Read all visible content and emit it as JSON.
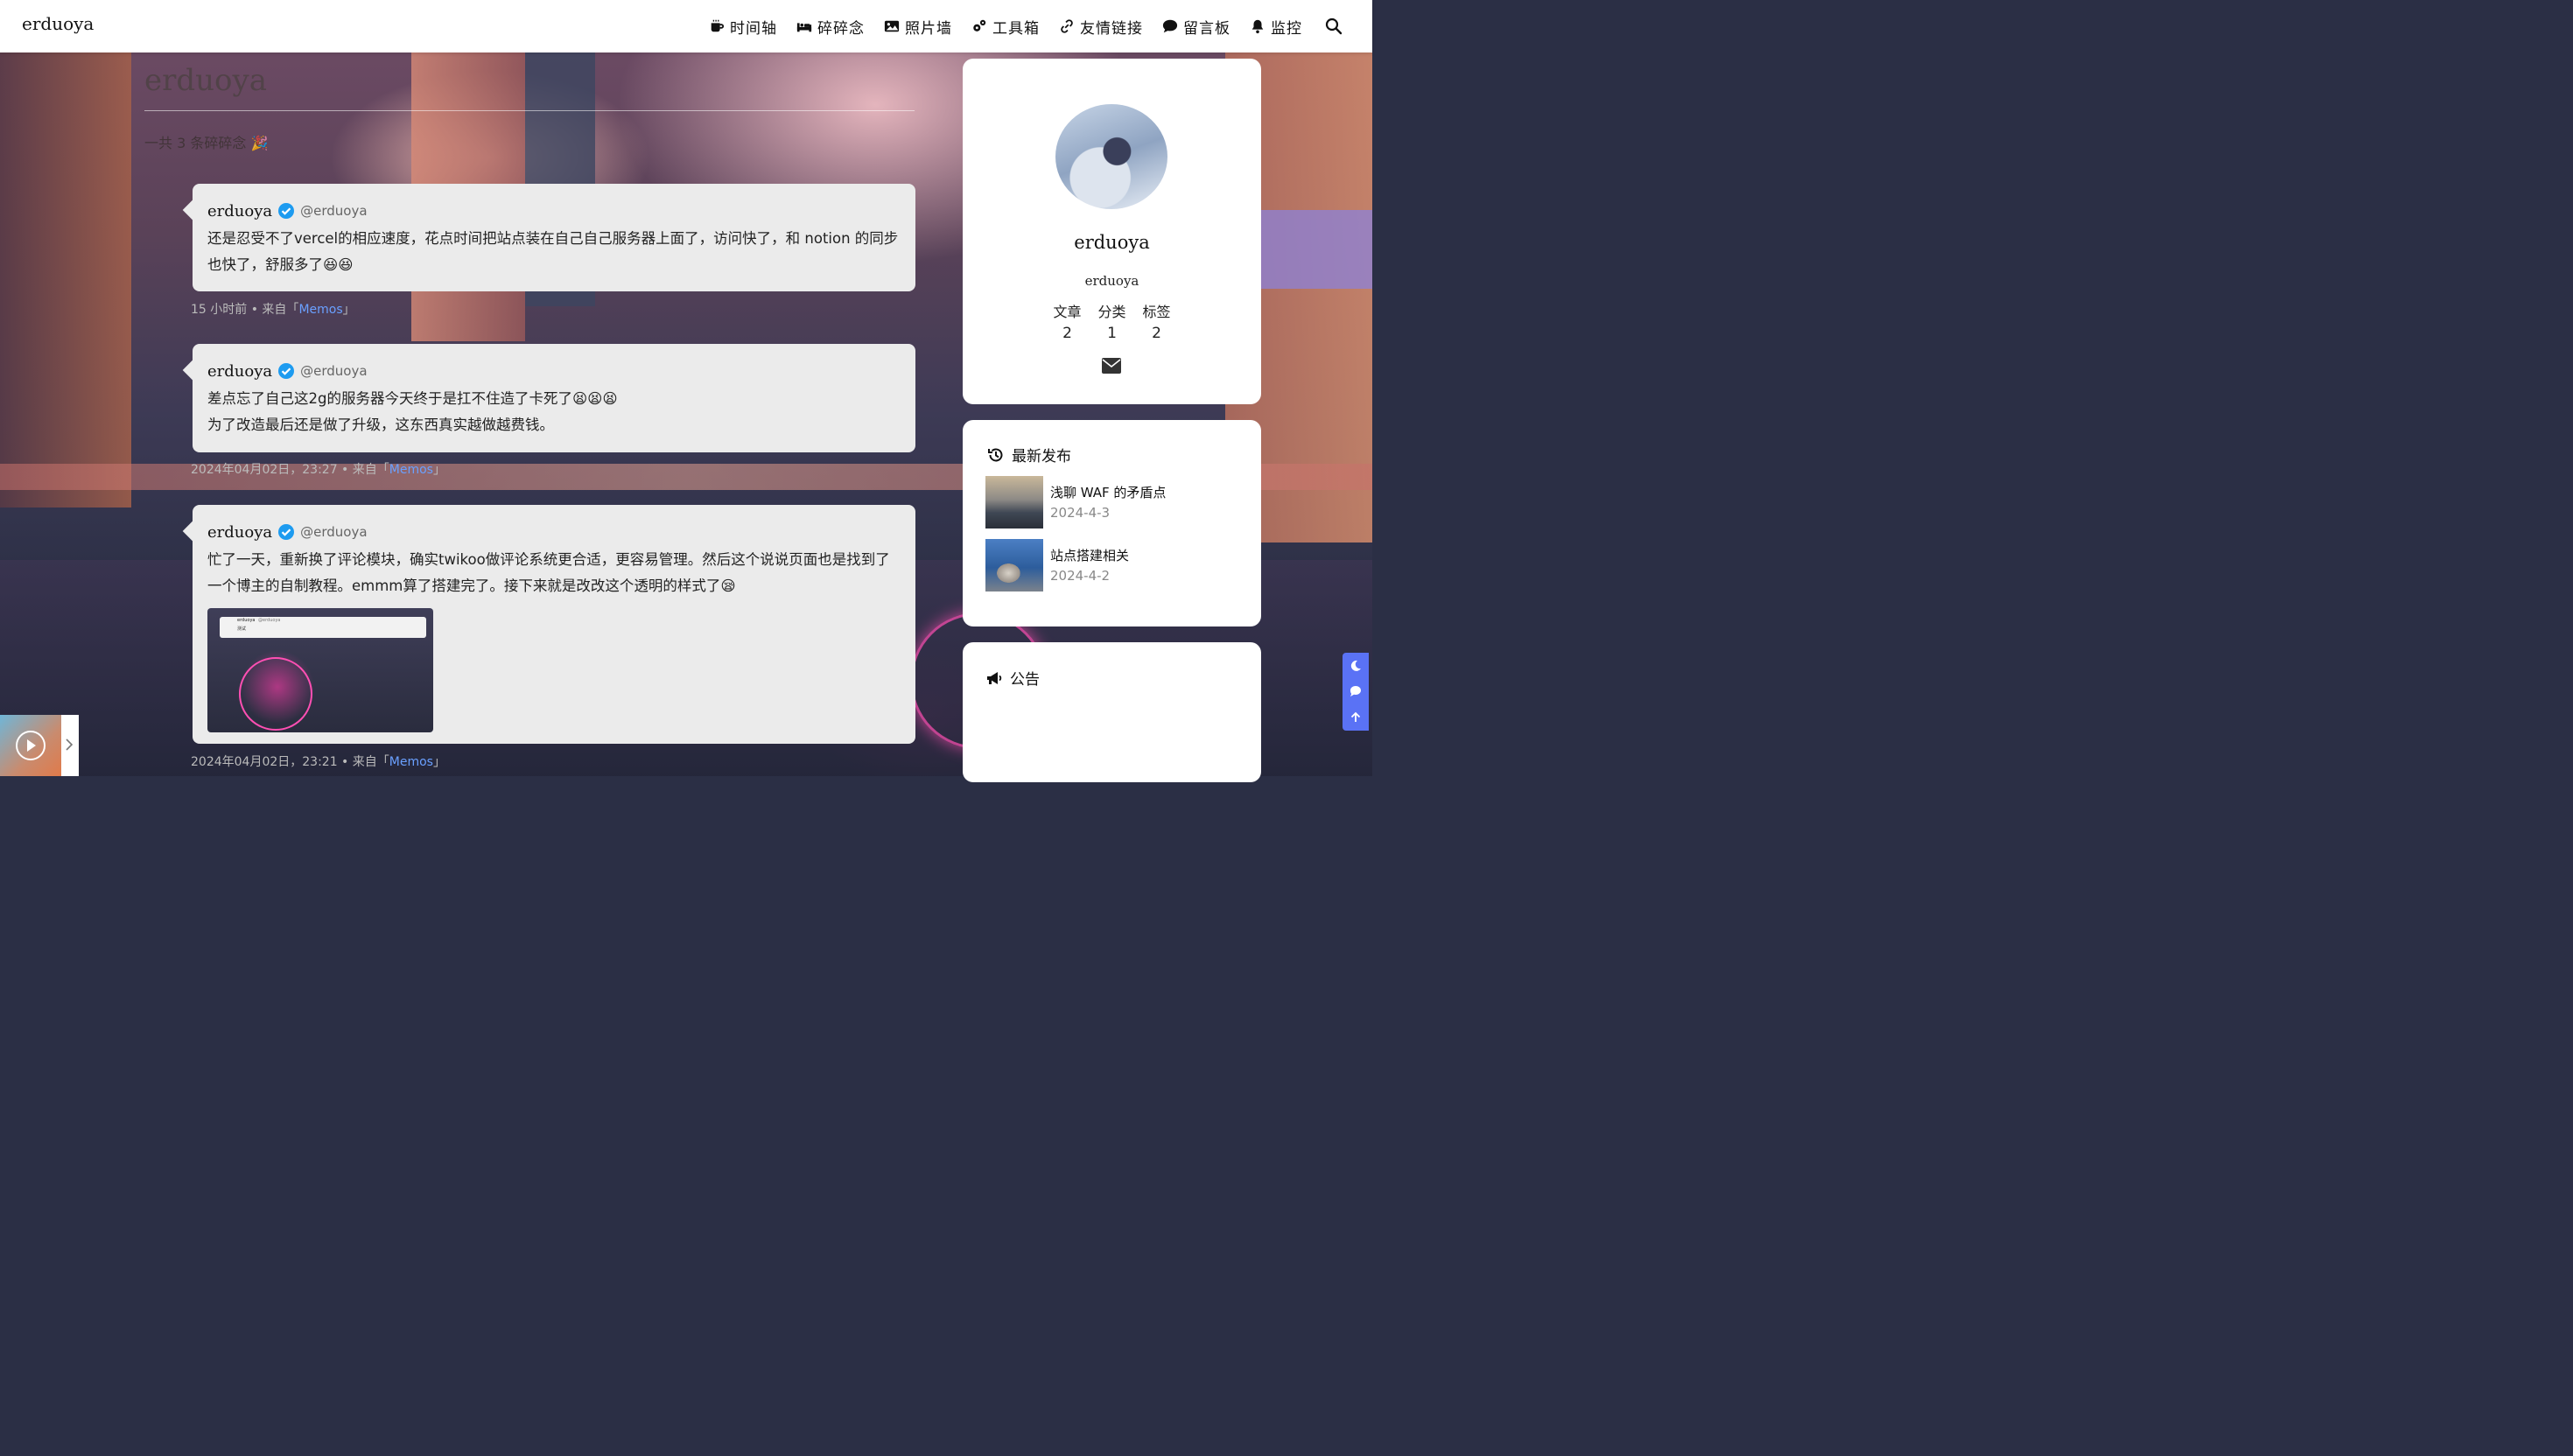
{
  "site": {
    "brand": "erduoya"
  },
  "nav": {
    "items": [
      {
        "label": "时间轴",
        "icon": "coffee-mug-icon"
      },
      {
        "label": "碎碎念",
        "icon": "bed-icon"
      },
      {
        "label": "照片墙",
        "icon": "image-icon"
      },
      {
        "label": "工具箱",
        "icon": "gears-icon"
      },
      {
        "label": "友情链接",
        "icon": "link-icon"
      },
      {
        "label": "留言板",
        "icon": "comment-icon"
      },
      {
        "label": "监控",
        "icon": "bell-icon"
      }
    ],
    "search_icon": "search-icon"
  },
  "page": {
    "title": "erduoya",
    "subtitle": "一共 3 条碎碎念 🎉"
  },
  "memos": [
    {
      "name": "erduoya",
      "handle": "@erduoya",
      "text": "还是忍受不了vercel的相应速度，花点时间把站点装在自己自己服务器上面了，访问快了，和 notion 的同步也快了，舒服多了😆😆",
      "time": "15 小时前",
      "from_prefix": " • 来自「",
      "source": "Memos",
      "from_suffix": "」"
    },
    {
      "name": "erduoya",
      "handle": "@erduoya",
      "text": "差点忘了自己这2g的服务器今天终于是扛不住造了卡死了😫😫😫",
      "text2": "为了改造最后还是做了升级，这东西真实越做越费钱。",
      "time": "2024年04月02日，23:27",
      "from_prefix": " • 来自「",
      "source": "Memos",
      "from_suffix": "」"
    },
    {
      "name": "erduoya",
      "handle": "@erduoya",
      "text": "忙了一天，重新换了评论模块，确实twikoo做评论系统更合适，更容易管理。然后这个说说页面也是找到了一个博主的自制教程。emmm算了搭建完了。接下来就是改改这个透明的样式了😪",
      "time": "2024年04月02日，23:21",
      "from_prefix": " • 来自「",
      "source": "Memos",
      "from_suffix": "」",
      "thumb_name": "erduoya",
      "thumb_handle": "@erduoya",
      "thumb_text": "测试"
    }
  ],
  "profile": {
    "name": "erduoya",
    "subtitle": "erduoya",
    "stats": [
      {
        "label": "文章",
        "value": "2"
      },
      {
        "label": "分类",
        "value": "1"
      },
      {
        "label": "标签",
        "value": "2"
      }
    ]
  },
  "recent": {
    "heading": "最新发布",
    "posts": [
      {
        "title": "浅聊 WAF 的矛盾点",
        "date": "2024-4-3"
      },
      {
        "title": "站点搭建相关",
        "date": "2024-4-2"
      }
    ]
  },
  "notice": {
    "heading": "公告"
  },
  "colors": {
    "accent": "#5a72f5",
    "link": "#6aa0ff",
    "verified": "#1d9bf0",
    "card_bg": "#ebebeb"
  }
}
